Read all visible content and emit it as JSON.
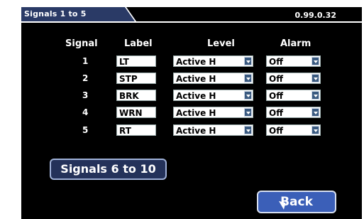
{
  "tab": {
    "title": "Signals 1 to 5"
  },
  "version": "0.99.0.32",
  "headers": {
    "signal": "Signal",
    "label": "Label",
    "level": "Level",
    "alarm": "Alarm"
  },
  "rows": [
    {
      "signal": "1",
      "label": "LT",
      "level": "Active H",
      "alarm": "Off"
    },
    {
      "signal": "2",
      "label": "STP",
      "level": "Active H",
      "alarm": "Off"
    },
    {
      "signal": "3",
      "label": "BRK",
      "level": "Active H",
      "alarm": "Off"
    },
    {
      "signal": "4",
      "label": "WRN",
      "level": "Active H",
      "alarm": "Off"
    },
    {
      "signal": "5",
      "label": "RT",
      "level": "Active H",
      "alarm": "Off"
    }
  ],
  "buttons": {
    "next_page": "Signals 6 to 10",
    "back": "Back"
  },
  "icons": {
    "dropdown": "chevron-down-icon",
    "pointer": "cursor-icon"
  },
  "colors": {
    "tab": "#2a3a66",
    "button": "#24325a",
    "back_button": "#3b5fb8",
    "dropdown": "#3a5a80"
  }
}
